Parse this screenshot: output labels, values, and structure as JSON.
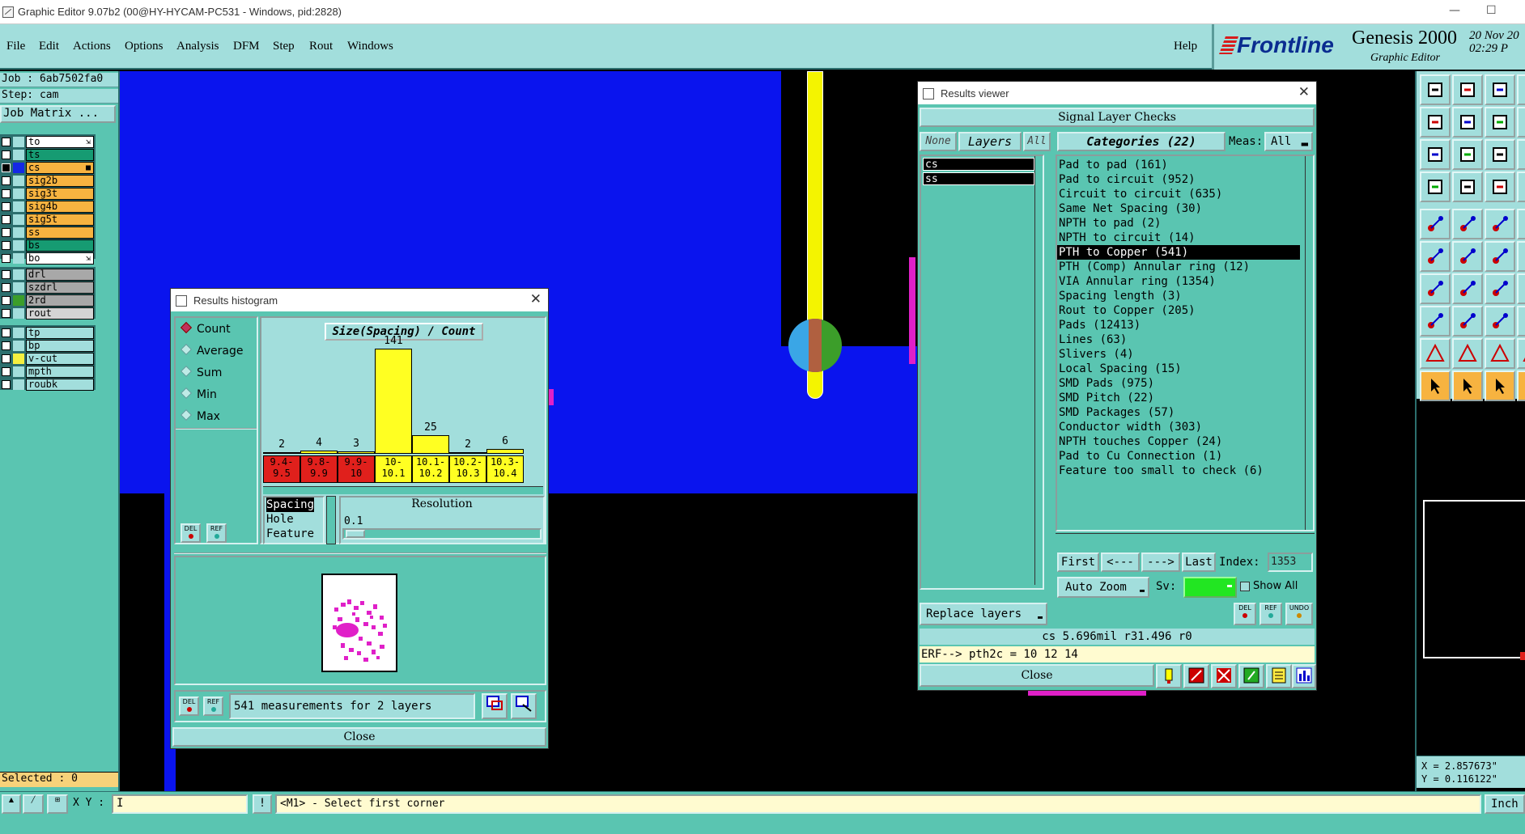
{
  "window": {
    "title": "Graphic Editor 9.07b2 (00@HY-HYCAM-PC531 - Windows, pid:2828)",
    "minimize": "—",
    "maximize": "☐"
  },
  "menu": [
    "File",
    "Edit",
    "Actions",
    "Options",
    "Analysis",
    "DFM",
    "Step",
    "Rout",
    "Windows"
  ],
  "help": "Help",
  "brand": {
    "logo": "Frontline",
    "product": "Genesis 2000",
    "subtitle": "Graphic Editor",
    "date": "20 Nov 20",
    "time": "02:29 P"
  },
  "job": {
    "job": "Job  : 6ab7502fa0",
    "step": "Step: cam",
    "matrix_button": "Job Matrix ..."
  },
  "layers": [
    {
      "name": "to",
      "color": "#ffffff",
      "swatch": "#a2dedc",
      "arrow": "⇲"
    },
    {
      "name": "ts",
      "color": "#169b72",
      "swatch": "#a2dedc"
    },
    {
      "name": "cs",
      "color": "#f7b340",
      "swatch": "#1428e6",
      "checked": true,
      "mark": "■"
    },
    {
      "name": "sig2b",
      "color": "#f7b340",
      "swatch": "#a2dedc"
    },
    {
      "name": "sig3t",
      "color": "#f7b340",
      "swatch": "#a2dedc"
    },
    {
      "name": "sig4b",
      "color": "#f7b340",
      "swatch": "#a2dedc"
    },
    {
      "name": "sig5t",
      "color": "#f7b340",
      "swatch": "#a2dedc"
    },
    {
      "name": "ss",
      "color": "#f7b340",
      "swatch": "#a2dedc"
    },
    {
      "name": "bs",
      "color": "#169b72",
      "swatch": "#a2dedc"
    },
    {
      "name": "bo",
      "color": "#ffffff",
      "swatch": "#a2dedc",
      "arrow": "⇲"
    }
  ],
  "layers2": [
    {
      "name": "drl",
      "color": "#a8a8a8",
      "swatch": "#a2dedc"
    },
    {
      "name": "szdrl",
      "color": "#a8a8a8",
      "swatch": "#a2dedc"
    },
    {
      "name": "2rd",
      "color": "#a8a8a8",
      "swatch": "#3c9e2a"
    },
    {
      "name": "rout",
      "color": "#d4d4d4",
      "swatch": "#a2dedc"
    }
  ],
  "layers3": [
    {
      "name": "tp",
      "color": "#a2dedc",
      "swatch": "#a2dedc"
    },
    {
      "name": "bp",
      "color": "#a2dedc",
      "swatch": "#a2dedc"
    },
    {
      "name": "v-cut",
      "color": "#a2dedc",
      "swatch": "#f5f040"
    },
    {
      "name": "mpth",
      "color": "#a2dedc",
      "swatch": "#a2dedc"
    },
    {
      "name": "roubk",
      "color": "#a2dedc",
      "swatch": "#a2dedc"
    }
  ],
  "selected": "Selected : 0",
  "histogram": {
    "title": "Results histogram",
    "modes": [
      "Count",
      "Average",
      "Sum",
      "Min",
      "Max"
    ],
    "chart_title": "Size(Spacing) / Count",
    "bars": [
      {
        "label": "9.4-\n9.5",
        "value": "2",
        "count": 2,
        "fill": "#e0201c"
      },
      {
        "label": "9.8-\n9.9",
        "value": "4",
        "count": 4,
        "fill": "#e0201c"
      },
      {
        "label": "9.9-\n10",
        "value": "3",
        "count": 3,
        "fill": "#e0201c"
      },
      {
        "label": "10-\n10.1",
        "value": "141",
        "count": 141,
        "fill": "#ffff22"
      },
      {
        "label": "10.1-\n10.2",
        "value": "25",
        "count": 25,
        "fill": "#ffff22"
      },
      {
        "label": "10.2-\n10.3",
        "value": "2",
        "count": 2,
        "fill": "#ffff22"
      },
      {
        "label": "10.3-\n10.4",
        "value": "6",
        "count": 6,
        "fill": "#ffff22"
      }
    ],
    "types": [
      "Spacing",
      "Hole",
      "Feature"
    ],
    "resolution_label": "Resolution",
    "resolution": "0.1",
    "del": "DEL",
    "ref": "REF",
    "status": "541 measurements for 2 layers",
    "close": "Close"
  },
  "results": {
    "title": "Results viewer",
    "header": "Signal Layer Checks",
    "none": "None",
    "layers": "Layers",
    "all": "All",
    "categories": "Categories (22)",
    "meas_label": "Meas:",
    "meas_value": "All",
    "layer_list": [
      "cs",
      "ss"
    ],
    "category_list": [
      "Pad to pad (161)",
      "Pad to circuit (952)",
      "Circuit to circuit (635)",
      "Same Net Spacing (30)",
      "NPTH to pad (2)",
      "NPTH to circuit (14)",
      "PTH to Copper (541)",
      "PTH (Comp) Annular ring (12)",
      "VIA Annular ring (1354)",
      "Spacing length (3)",
      "Rout to Copper (205)",
      "Pads (12413)",
      "Lines (63)",
      "Slivers (4)",
      "Local Spacing (15)",
      "SMD Pads (975)",
      "SMD Pitch (22)",
      "SMD Packages (57)",
      "Conductor width (303)",
      "NPTH touches Copper (24)",
      "Pad to Cu Connection (1)",
      "Feature too small to check (6)"
    ],
    "first": "First",
    "prev": "<---",
    "next": "--->",
    "last": "Last",
    "index_label": "Index:",
    "index_value": "1353",
    "auto_zoom": "Auto Zoom",
    "sv": "Sv:",
    "show_all": "Show All",
    "replace_layers": "Replace layers",
    "del": "DEL",
    "ref": "REF",
    "undo": "UNDO",
    "info_line": "cs 5.696mil  r31.496  r0",
    "erf_line": "ERF--> pth2c = 10 12 14",
    "close": "Close"
  },
  "coords": {
    "x": "X = 2.857673\"",
    "y": "Y = 0.116122\""
  },
  "status": {
    "xy_label": "X Y :",
    "message": "<M1> - Select first corner",
    "units": "Inch",
    "bang": "!"
  }
}
